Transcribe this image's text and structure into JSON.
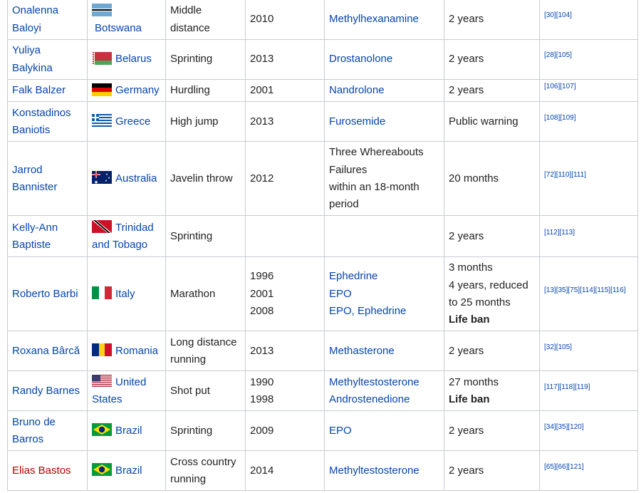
{
  "rows": [
    {
      "name": [
        "Onalenna",
        "Baloyi"
      ],
      "name_new": false,
      "flag": "botswana-flag",
      "country": [
        "Botswana"
      ],
      "country_below": true,
      "event": [
        "Middle",
        "distance"
      ],
      "year": [
        "2010"
      ],
      "substance": [
        "Methylhexanamine"
      ],
      "substance_link": true,
      "ban": [
        "2 years"
      ],
      "ban_bold": [],
      "refs": [
        "[30]",
        "[104]"
      ]
    },
    {
      "name": [
        "Yuliya",
        "Balykina"
      ],
      "name_new": false,
      "flag": "belarus-flag",
      "country": [
        "Belarus"
      ],
      "event": [
        "Sprinting"
      ],
      "year": [
        "2013"
      ],
      "substance": [
        "Drostanolone"
      ],
      "substance_link": true,
      "ban": [
        "2 years"
      ],
      "ban_bold": [],
      "refs": [
        "[28]",
        "[105]"
      ]
    },
    {
      "name": [
        "Falk Balzer"
      ],
      "name_new": false,
      "flag": "germany-flag",
      "country": [
        "Germany"
      ],
      "event": [
        "Hurdling"
      ],
      "year": [
        "2001"
      ],
      "substance": [
        "Nandrolone"
      ],
      "substance_link": true,
      "ban": [
        "2 years"
      ],
      "ban_bold": [],
      "refs": [
        "[106]",
        "[107]"
      ]
    },
    {
      "name": [
        "Konstadinos",
        "Baniotis"
      ],
      "name_new": false,
      "flag": "greece-flag",
      "country": [
        "Greece"
      ],
      "event": [
        "High jump"
      ],
      "year": [
        "2013"
      ],
      "substance": [
        "Furosemide"
      ],
      "substance_link": true,
      "ban": [
        "Public warning"
      ],
      "ban_bold": [],
      "refs": [
        "[108]",
        "[109]"
      ]
    },
    {
      "name": [
        "Jarrod",
        "Bannister"
      ],
      "name_new": false,
      "flag": "australia-flag",
      "country": [
        "Australia"
      ],
      "event": [
        "Javelin throw"
      ],
      "year": [
        "2012"
      ],
      "substance": [
        "Three Whereabouts",
        "Failures",
        "within an 18-month",
        "period"
      ],
      "substance_link": false,
      "ban": [
        "20 months"
      ],
      "ban_bold": [],
      "refs": [
        "[72]",
        "[110]",
        "[111]"
      ]
    },
    {
      "name": [
        "Kelly-Ann",
        "Baptiste"
      ],
      "name_new": false,
      "flag": "trinidad-flag",
      "country": [
        "Trinidad",
        "and Tobago"
      ],
      "event": [
        "Sprinting"
      ],
      "year": [],
      "substance": [],
      "substance_link": true,
      "ban": [
        "2 years"
      ],
      "ban_bold": [],
      "refs": [
        "[112]",
        "[113]"
      ]
    },
    {
      "name": [
        "Roberto Barbi"
      ],
      "name_new": false,
      "flag": "italy-flag",
      "country": [
        "Italy"
      ],
      "event": [
        "Marathon"
      ],
      "year": [
        "1996",
        "2001",
        "2008"
      ],
      "substance": [
        "Ephedrine",
        "EPO",
        "EPO, Ephedrine"
      ],
      "substance_link": true,
      "ban": [
        "3 months",
        "4 years, reduced",
        "to 25 months"
      ],
      "ban_bold": [
        "Life ban"
      ],
      "refs": [
        "[13]",
        "[35]",
        "[75]",
        "[114]",
        "[115]",
        "[116]"
      ]
    },
    {
      "name": [
        "Roxana Bârcă"
      ],
      "name_new": false,
      "flag": "romania-flag",
      "country": [
        "Romania"
      ],
      "event": [
        "Long distance",
        "running"
      ],
      "year": [
        "2013"
      ],
      "substance": [
        "Methasterone"
      ],
      "substance_link": true,
      "ban": [
        "2 years"
      ],
      "ban_bold": [],
      "refs": [
        "[32]",
        "[105]"
      ]
    },
    {
      "name": [
        "Randy Barnes"
      ],
      "name_new": false,
      "flag": "usa-flag",
      "country": [
        "United",
        "States"
      ],
      "event": [
        "Shot put"
      ],
      "year": [
        "1990",
        "1998"
      ],
      "substance": [
        "Methyltestosterone",
        "Androstenedione"
      ],
      "substance_link": true,
      "ban": [
        "27 months"
      ],
      "ban_bold": [
        "Life ban"
      ],
      "refs": [
        "[117]",
        "[118]",
        "[119]"
      ]
    },
    {
      "name": [
        "Bruno de",
        "Barros"
      ],
      "name_new": false,
      "flag": "brazil-flag",
      "country": [
        "Brazil"
      ],
      "event": [
        "Sprinting"
      ],
      "year": [
        "2009"
      ],
      "substance": [
        "EPO"
      ],
      "substance_link": true,
      "ban": [
        "2 years"
      ],
      "ban_bold": [],
      "refs": [
        "[34]",
        "[35]",
        "[120]"
      ]
    },
    {
      "name": [
        "Elias Bastos"
      ],
      "name_new": true,
      "flag": "brazil-flag",
      "country": [
        "Brazil"
      ],
      "event": [
        "Cross country",
        "running"
      ],
      "year": [
        "2014"
      ],
      "substance": [
        "Methyltestosterone"
      ],
      "substance_link": true,
      "ban": [
        "2 years"
      ],
      "ban_bold": [],
      "refs": [
        "[65]",
        "[66]",
        "[121]"
      ]
    }
  ],
  "colors": {
    "link": "#0645ad",
    "new_link": "#ba0000",
    "border": "#c8ccd1"
  }
}
